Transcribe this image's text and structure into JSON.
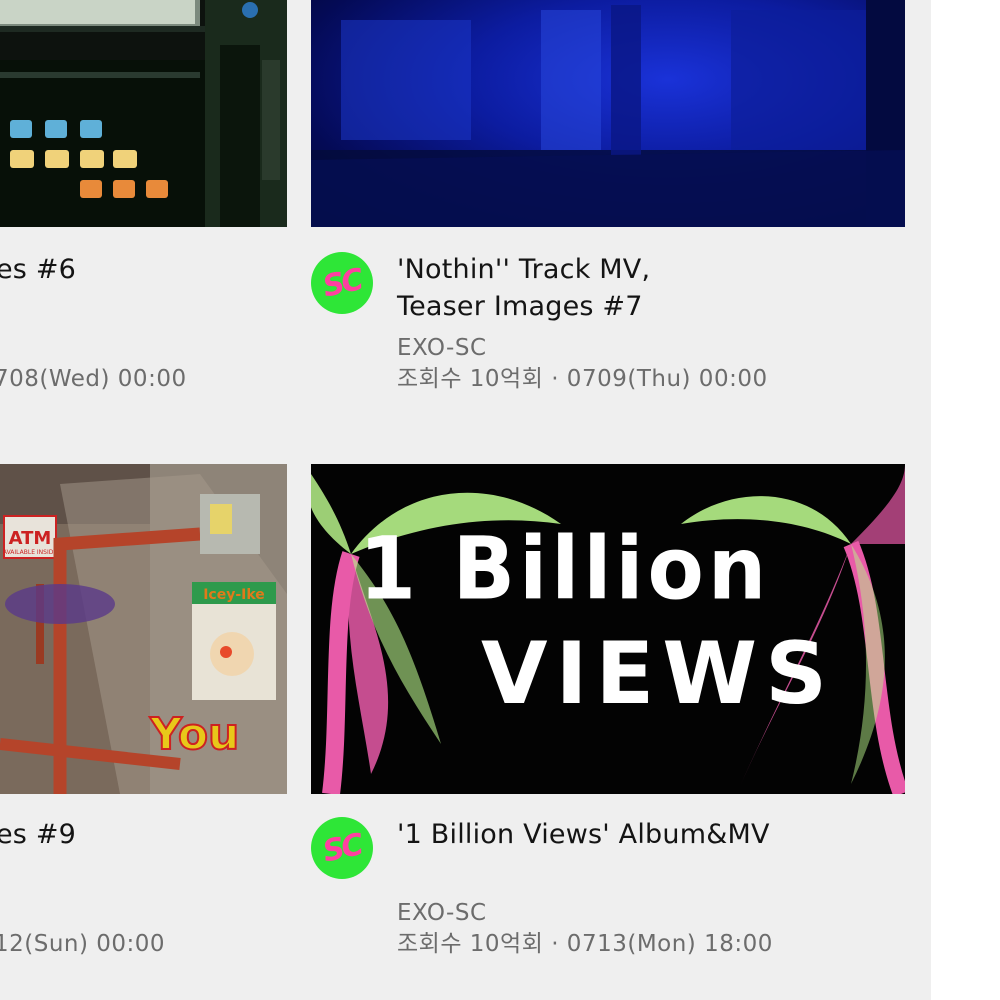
{
  "cards": {
    "l1": {
      "title": "es #6",
      "meta": "708(Wed) 00:00"
    },
    "r1": {
      "avatar": "SC",
      "title_line1": "'Nothin'' Track MV,",
      "title_line2": "Teaser Images #7",
      "channel": "EXO-SC",
      "meta": "조회수 10억회 · 0709(Thu) 00:00"
    },
    "l2": {
      "title": "es #9",
      "meta": "12(Sun) 00:00"
    },
    "r2": {
      "avatar": "SC",
      "title_line1": "'1 Billion Views' Album&MV",
      "channel": "EXO-SC",
      "meta": "조회수 10억회 · 0713(Mon) 18:00"
    }
  },
  "thumbnails": {
    "l2_signs": {
      "atm": "ATM",
      "atm_sub": "AVAILABLE INSIDE",
      "poster": "Icey-Ike",
      "graffiti": "You"
    },
    "r2_art": {
      "line1": "1 Billion",
      "line2": "VIEWS"
    }
  },
  "colors": {
    "avatar_bg": "#2ee637",
    "avatar_text": "#ff3fa0",
    "panel_bg": "#efefef"
  }
}
